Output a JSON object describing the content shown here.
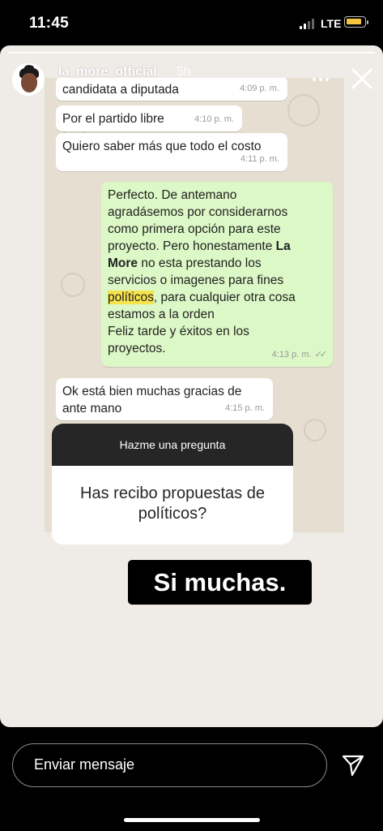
{
  "status_bar": {
    "time": "11:45",
    "network": "LTE",
    "battery_level": 0.9
  },
  "story": {
    "username": "la_more_official",
    "time_ago": "5h",
    "progress": 1.0
  },
  "chat": {
    "messages": [
      {
        "text": "candidata a diputada",
        "time": "4:09 p. m."
      },
      {
        "text": "Por el partido libre",
        "time": "4:10 p. m."
      },
      {
        "text": "Quiero saber más que todo el costo",
        "time": "4:11 p. m."
      },
      {
        "lines": [
          "Perfecto. De antemano",
          "agradásemos por considerarnos",
          "como primera opción para este",
          "proyecto. Pero honestamente ",
          "La",
          "More",
          " no esta prestando los",
          "servicios o imagenes para fines",
          "políticos",
          ", para cualquier otra cosa",
          "estamos a la orden",
          "Feliz tarde y éxitos en los",
          "proyectos."
        ],
        "time": "4:13 p. m."
      },
      {
        "text": "Ok está bien muchas gracias de",
        "text2": "ante mano",
        "time": "4:15 p. m."
      }
    ]
  },
  "question": {
    "header": "Hazme una pregunta",
    "text": "Has recibo propuestas de",
    "text2": "políticos?"
  },
  "answer": "Si muchas.",
  "composer": {
    "placeholder": "Enviar mensaje"
  },
  "icons": {
    "more": "more-icon",
    "close": "close-icon",
    "send": "send-icon"
  }
}
